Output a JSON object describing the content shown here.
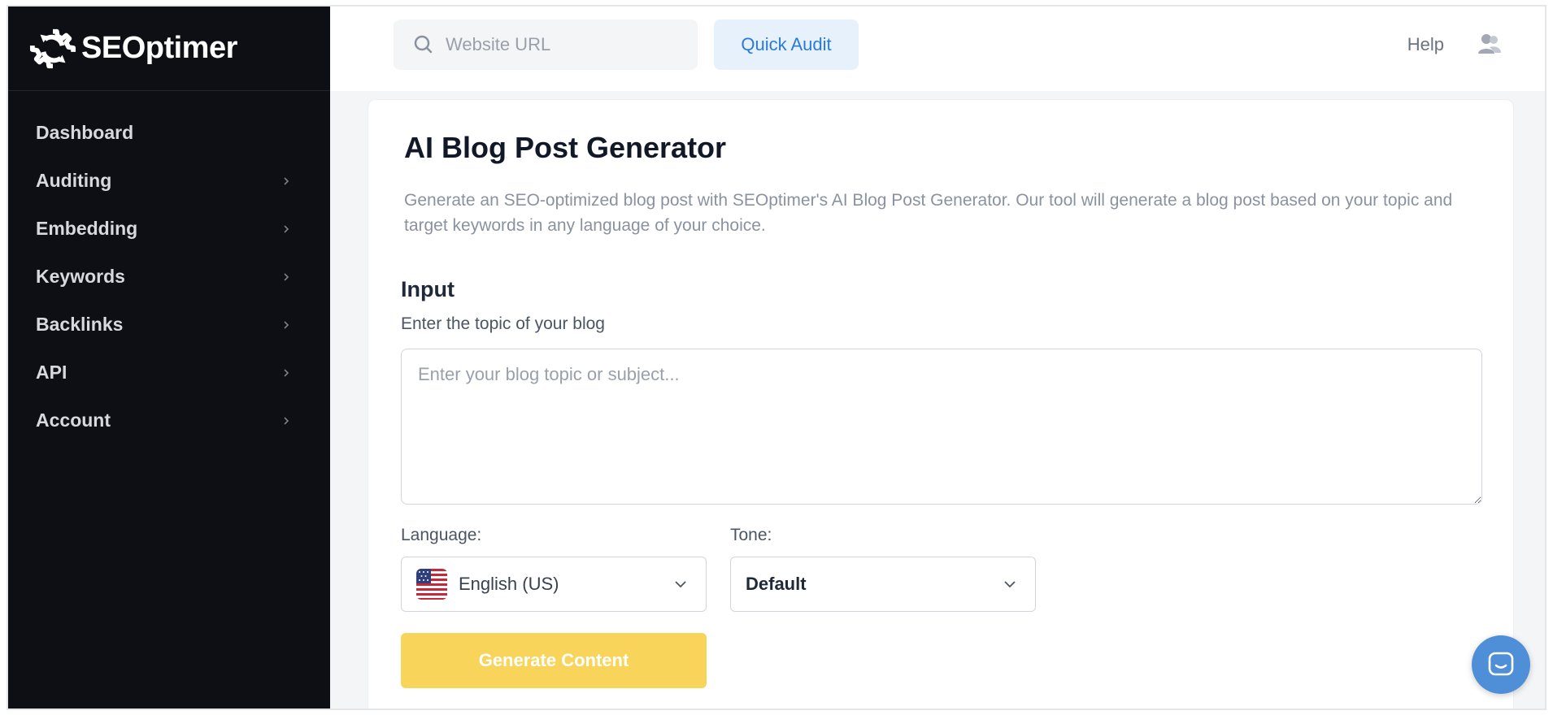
{
  "brand": {
    "name": "SEOptimer"
  },
  "sidebar": {
    "items": [
      {
        "label": "Dashboard",
        "has_submenu": false
      },
      {
        "label": "Auditing",
        "has_submenu": true
      },
      {
        "label": "Embedding",
        "has_submenu": true
      },
      {
        "label": "Keywords",
        "has_submenu": true
      },
      {
        "label": "Backlinks",
        "has_submenu": true
      },
      {
        "label": "API",
        "has_submenu": true
      },
      {
        "label": "Account",
        "has_submenu": true
      }
    ]
  },
  "header": {
    "search_placeholder": "Website URL",
    "quick_audit_label": "Quick Audit",
    "help_label": "Help"
  },
  "main": {
    "title": "AI Blog Post Generator",
    "description": "Generate an SEO-optimized blog post with SEOptimer's AI Blog Post Generator. Our tool will generate a blog post based on your topic and target keywords in any language of your choice.",
    "section_title": "Input",
    "topic_label": "Enter the topic of your blog",
    "topic_placeholder": "Enter your blog topic or subject...",
    "topic_value": "",
    "language_label": "Language:",
    "language_value": "English (US)",
    "tone_label": "Tone:",
    "tone_value": "Default",
    "generate_label": "Generate Content"
  },
  "colors": {
    "sidebar_bg": "#0d0f14",
    "accent_blue": "#2b7bd6",
    "generate_button": "#f8d55a",
    "chat_bubble": "#4f8fd8"
  },
  "icons": {
    "logo": "gear-refresh-logo-icon",
    "search": "search-icon",
    "user": "users-icon",
    "chat": "chat-bubble-icon",
    "flag": "us-flag-icon"
  }
}
